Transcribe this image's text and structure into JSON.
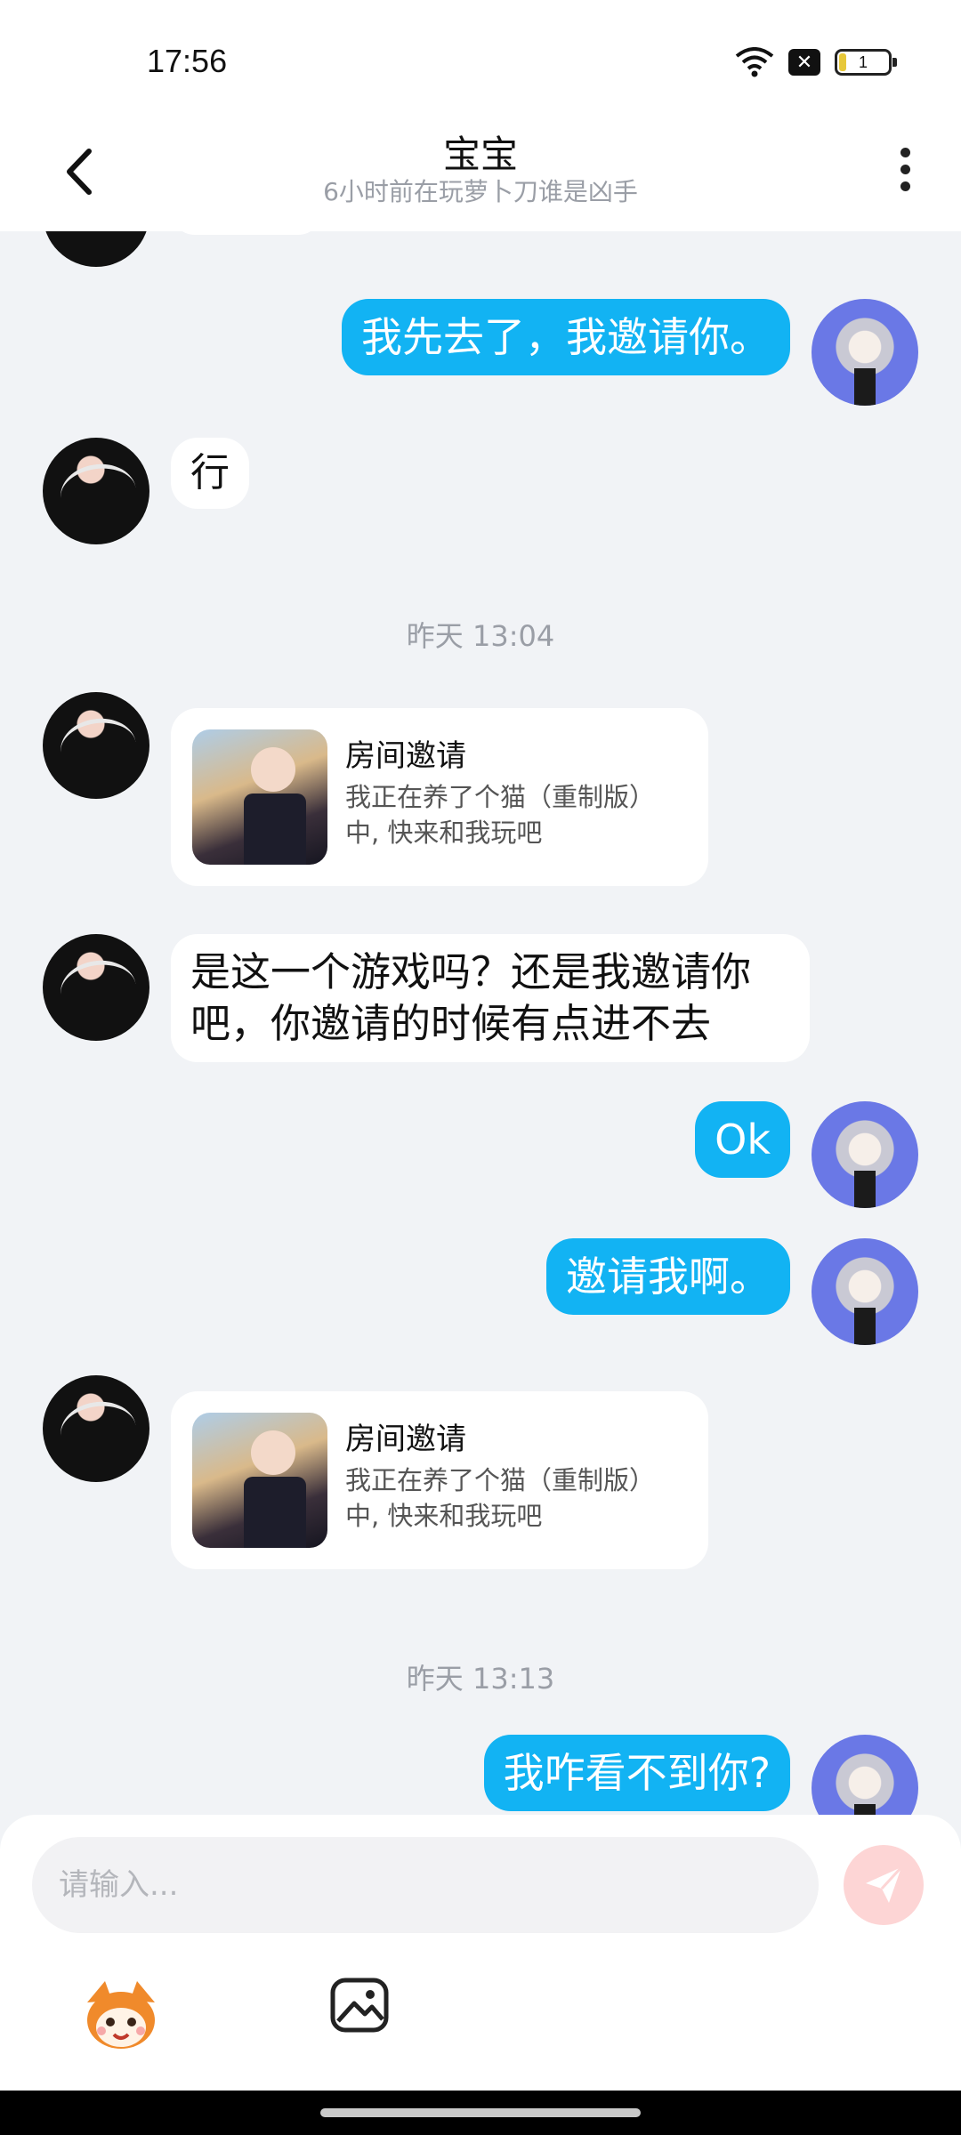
{
  "status": {
    "time": "17:56",
    "battery": "1"
  },
  "header": {
    "title": "宝宝",
    "subtitle": "6小时前在玩萝卜刀谁是凶手"
  },
  "messages": {
    "m1": "我先去了，我邀请你。",
    "m2": "行",
    "ts1": "昨天 13:04",
    "card1": {
      "title": "房间邀请",
      "text": "我正在养了个猫（重制版）中, 快来和我玩吧"
    },
    "m3": "是这一个游戏吗？还是我邀请你吧，你邀请的时候有点进不去",
    "m4": "Ok",
    "m5": "邀请我啊。",
    "card2": {
      "title": "房间邀请",
      "text": "我正在养了个猫（重制版）中, 快来和我玩吧"
    },
    "ts2": "昨天 13:13",
    "m6": "我咋看不到你?"
  },
  "composer": {
    "placeholder": "请输入..."
  },
  "colors": {
    "outgoing_bubble": "#12b3f3",
    "send_button": "#fdd5d5"
  },
  "icons": [
    "back-arrow-icon",
    "more-vertical-icon",
    "wifi-icon",
    "sim-off-icon",
    "battery-icon",
    "send-icon",
    "mascot-icon",
    "image-icon"
  ]
}
